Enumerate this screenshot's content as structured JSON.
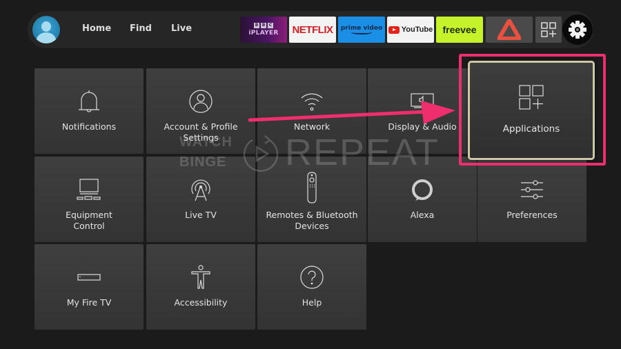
{
  "nav": {
    "links": [
      "Home",
      "Find",
      "Live"
    ],
    "apps": {
      "bbc": {
        "blocks": [
          "B",
          "B",
          "C"
        ],
        "label": "iPLAYER"
      },
      "netflix": "NETFLIX",
      "prime": "prime video",
      "youtube": "YouTube",
      "freevee": "freevee"
    }
  },
  "tiles": [
    {
      "label": "Notifications",
      "icon": "bell-icon"
    },
    {
      "label": "Account & Profile Settings",
      "icon": "user-circle-icon"
    },
    {
      "label": "Network",
      "icon": "wifi-icon"
    },
    {
      "label": "Display & Audio",
      "icon": "display-audio-icon"
    },
    {
      "label": "Applications",
      "icon": "apps-add-icon",
      "focused": true
    },
    {
      "label": "Equipment Control",
      "icon": "tv-equipment-icon"
    },
    {
      "label": "Live TV",
      "icon": "antenna-icon"
    },
    {
      "label": "Remotes & Bluetooth Devices",
      "icon": "remote-icon"
    },
    {
      "label": "Alexa",
      "icon": "alexa-icon"
    },
    {
      "label": "Preferences",
      "icon": "sliders-icon"
    },
    {
      "label": "My Fire TV",
      "icon": "fire-tv-stick-icon"
    },
    {
      "label": "Accessibility",
      "icon": "accessibility-icon"
    },
    {
      "label": "Help",
      "icon": "help-icon"
    }
  ],
  "labels": {
    "notifications": "Notifications",
    "account_1": "Account & Profile",
    "account_2": "Settings",
    "network": "Network",
    "display": "Display & Audio",
    "applications": "Applications",
    "equipment_1": "Equipment",
    "equipment_2": "Control",
    "livetv": "Live TV",
    "remotes_1": "Remotes & Bluetooth",
    "remotes_2": "Devices",
    "alexa": "Alexa",
    "preferences": "Preferences",
    "myfiretv": "My Fire TV",
    "accessibility": "Accessibility",
    "help": "Help"
  },
  "annotation": {
    "color": "#ee2e6d"
  },
  "watermark": {
    "line1": "WATCH",
    "line2": "BINGE",
    "word": "REPEAT"
  }
}
